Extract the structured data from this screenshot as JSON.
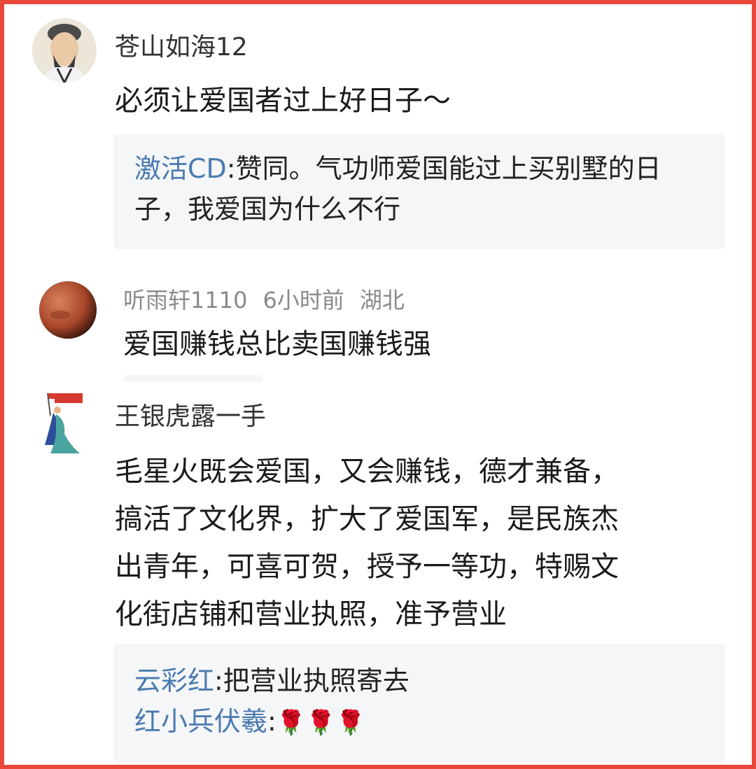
{
  "comments": [
    {
      "username": "苍山如海12",
      "text": "必须让爱国者过上好日子～",
      "replies": [
        {
          "name": "激活CD",
          "sep": ":",
          "text_line1": "赞同。气功师爱国能过上买别墅的日",
          "text_line2": "子，我爱国为什么不行"
        }
      ]
    },
    {
      "username": "听雨轩1110",
      "time": "6小时前",
      "location": "湖北",
      "text": "爱国赚钱总比卖国赚钱强"
    },
    {
      "username": "王银虎露一手",
      "text_lines": [
        "毛星火既会爱国，又会赚钱，德才兼备，",
        "搞活了文化界，扩大了爱国军，是民族杰",
        "出青年，可喜可贺，授予一等功，特赐文",
        "化街店铺和营业执照，准予营业"
      ],
      "replies": [
        {
          "name": "云彩红",
          "sep": ":",
          "text": "把营业执照寄去"
        },
        {
          "name": "红小兵伏羲",
          "sep": ":",
          "text": "🌹🌹🌹"
        }
      ]
    }
  ],
  "colors": {
    "frame": "#e8473a",
    "reply_name": "#4a7bb0",
    "reply_bg": "#f5f6f8"
  }
}
